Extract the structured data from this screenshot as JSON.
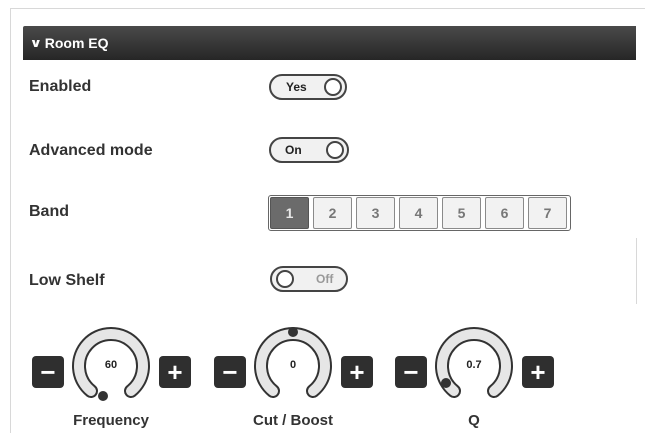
{
  "section": {
    "title": "Room EQ"
  },
  "rows": {
    "enabled": {
      "label": "Enabled",
      "toggle": "Yes",
      "on": true
    },
    "advanced": {
      "label": "Advanced mode",
      "toggle": "On",
      "on": true
    },
    "band": {
      "label": "Band",
      "options": [
        "1",
        "2",
        "3",
        "4",
        "5",
        "6",
        "7"
      ],
      "selected": "1"
    },
    "low_shelf": {
      "label": "Low Shelf",
      "toggle": "Off",
      "on": false
    }
  },
  "knobs": [
    {
      "label": "Frequency",
      "value": "60"
    },
    {
      "label": "Cut / Boost",
      "value": "0"
    },
    {
      "label": "Q",
      "value": "0.7"
    }
  ],
  "icons": {
    "minus": "−",
    "plus": "+",
    "collapse": "chevron-down-icon"
  }
}
